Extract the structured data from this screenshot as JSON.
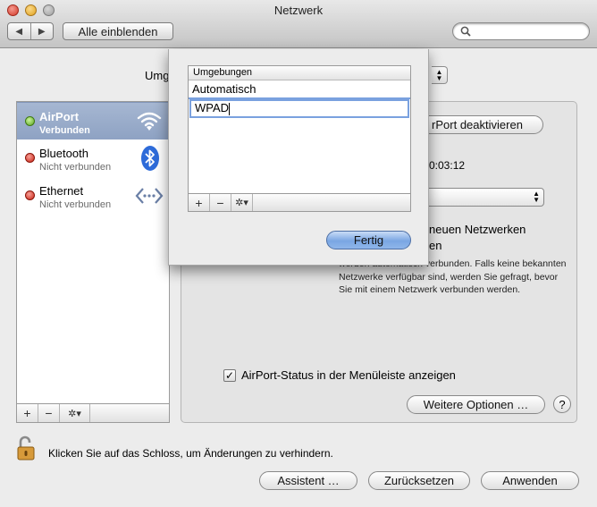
{
  "window": {
    "title": "Netzwerk"
  },
  "toolbar": {
    "back": "◀",
    "forward": "▶",
    "show_all": "Alle einblenden",
    "search_value": ""
  },
  "location": {
    "label": "Umg"
  },
  "sidebar": {
    "services": [
      {
        "name": "AirPort",
        "status": "Verbunden",
        "state": "green",
        "icon": "wifi-icon"
      },
      {
        "name": "Bluetooth",
        "status": "Nicht verbunden",
        "state": "red",
        "icon": "bluetooth-icon"
      },
      {
        "name": "Ethernet",
        "status": "Nicht verbunden",
        "state": "red",
        "icon": "ethernet-icon"
      }
    ],
    "add": "+",
    "remove": "−",
    "action": "✲▾"
  },
  "detail": {
    "turn_off": "rPort deaktivieren",
    "time": "0:03:12",
    "ask_line1": "neuen Netzwerken",
    "ask_line2": "en",
    "ask_desc": "werden automatisch verbunden. Falls keine bekannten Netzwerke verfügbar sind, werden Sie gefragt, bevor Sie mit einem Netzwerk verbunden werden.",
    "menubar_status": "AirPort-Status in der Menüleiste anzeigen",
    "menubar_checked": true,
    "more_options": "Weitere Optionen …",
    "help": "?"
  },
  "footer": {
    "lock_text": "Klicken Sie auf das Schloss, um Änderungen zu verhindern.",
    "assistant": "Assistent …",
    "revert": "Zurücksetzen",
    "apply": "Anwenden"
  },
  "sheet": {
    "column_header": "Umgebungen",
    "locations": [
      "Automatisch",
      "WPAD"
    ],
    "add": "+",
    "remove": "−",
    "action": "✲▾",
    "done": "Fertig"
  },
  "colors": {
    "accent": "#7aa6e3",
    "selection": "#8ea2c3"
  }
}
